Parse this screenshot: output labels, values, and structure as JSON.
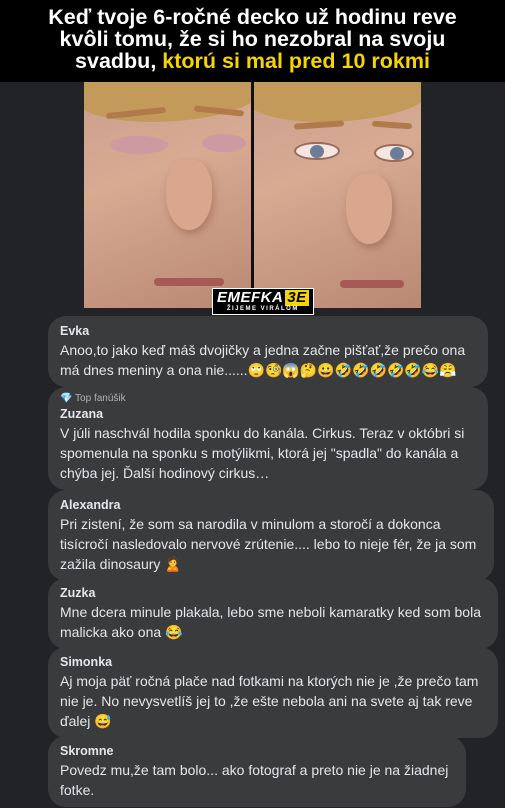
{
  "header": {
    "line1": "Keď tvoje 6-ročné decko už hodinu reve",
    "line2": "kvôli tomu, že si ho nezobral na svoju",
    "line3_plain": "svadbu,",
    "line3_highlight": "ktorú si mal pred 10 rokmi"
  },
  "meme": {
    "logo_main": "EMEFKA",
    "logo_badge": "3E",
    "logo_sub": "ŽIJEME VIRÁLOM"
  },
  "comments": [
    {
      "name": "Evka",
      "text": "Anoo,to jako keď máš dvojičky a jedna začne pišťať,že prečo ona má dnes meniny a ona nie......🙄🧐😱🤔😀🤣🤣🤣🤣🤣😂😤"
    },
    {
      "badge": "💎 Top fanúšik",
      "name": "Zuzana",
      "text": "V júli naschvál hodila sponku do kanála. Cirkus. Teraz v októbri si spomenula na sponku s motýlikmi, ktorá jej \"spadla\" do kanála a chýba jej. Ďalší hodinový cirkus…"
    },
    {
      "name": "Alexandra",
      "text": "Pri zistení, že som sa narodila v minulom a storočí a dokonca tisícročí nasledovalo nervové zrútenie.... lebo to nieje fér, že ja som zažila dinosaury 🙎"
    },
    {
      "name": "Zuzka",
      "text": "Mne dcera minule plakala, lebo sme neboli kamaratky ked som bola malicka ako ona 😂"
    },
    {
      "name": "Simonka",
      "text": "Aj moja päť ročná plače nad fotkami na ktorých nie je ,že prečo tam nie je. No nevysvetlíš jej to ,že ešte nebola ani na svete aj tak reve ďalej 😅"
    },
    {
      "name": "Skromne",
      "text": "Povedz mu,že tam bolo... ako fotograf a preto nie je na žiadnej fotke."
    }
  ]
}
